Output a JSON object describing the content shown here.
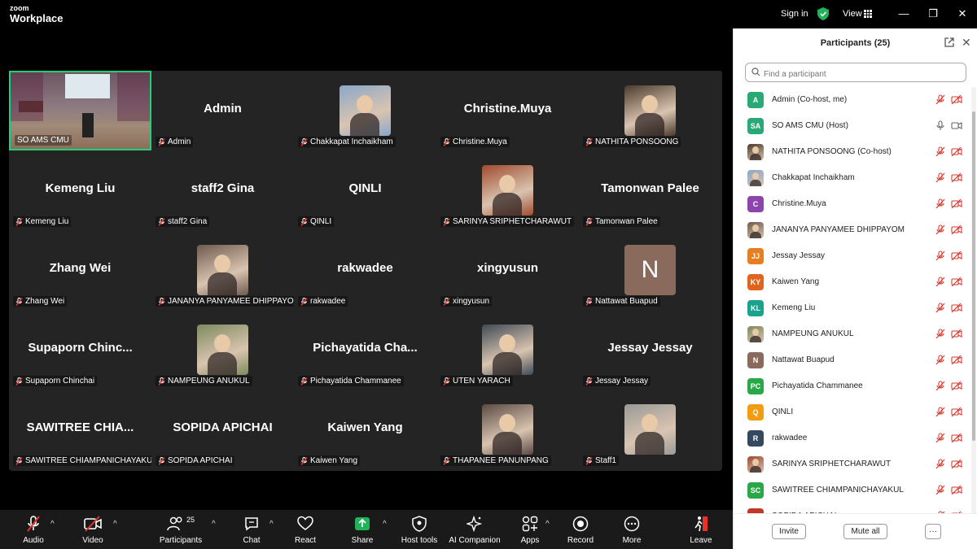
{
  "titlebar": {
    "logo_top": "zoom",
    "logo_bottom": "Workplace",
    "signin": "Sign in",
    "view": "View"
  },
  "tiles": [
    {
      "name": "",
      "label": "SO AMS CMU",
      "kind": "video",
      "row": 0,
      "col": 0
    },
    {
      "name": "Admin",
      "label": "Admin",
      "kind": "name",
      "row": 0,
      "col": 1
    },
    {
      "name": "",
      "label": "Chakkapat Inchaikham",
      "kind": "photo",
      "color": "#8aa7c9",
      "row": 0,
      "col": 2
    },
    {
      "name": "Christine.Muya",
      "label": "Christine.Muya",
      "kind": "name",
      "row": 0,
      "col": 3
    },
    {
      "name": "",
      "label": "NATHITA PONSOONG",
      "kind": "photo",
      "color": "#4b3a2b",
      "row": 0,
      "col": 4
    },
    {
      "name": "Kemeng Liu",
      "label": "Kemeng Liu",
      "kind": "name",
      "row": 1,
      "col": 0
    },
    {
      "name": "staff2 Gina",
      "label": "staff2 Gina",
      "kind": "name",
      "row": 1,
      "col": 1
    },
    {
      "name": "QINLI",
      "label": "QINLI",
      "kind": "name",
      "row": 1,
      "col": 2
    },
    {
      "name": "",
      "label": "SARINYA SRIPHETCHARAWUT",
      "kind": "photo",
      "color": "#a04a2e",
      "row": 1,
      "col": 3
    },
    {
      "name": "Tamonwan Palee",
      "label": "Tamonwan Palee",
      "kind": "name",
      "row": 1,
      "col": 4
    },
    {
      "name": "Zhang Wei",
      "label": "Zhang Wei",
      "kind": "name",
      "row": 2,
      "col": 0
    },
    {
      "name": "",
      "label": "JANANYA PANYAMEE DHIPPAYOM",
      "kind": "photo",
      "color": "#6e5a4e",
      "row": 2,
      "col": 1
    },
    {
      "name": "rakwadee",
      "label": "rakwadee",
      "kind": "name",
      "row": 2,
      "col": 2
    },
    {
      "name": "xingyusun",
      "label": "xingyusun",
      "kind": "name",
      "row": 2,
      "col": 3
    },
    {
      "name": "N",
      "label": "Nattawat Buapud",
      "kind": "letter",
      "color": "#8a6a5c",
      "row": 2,
      "col": 4
    },
    {
      "name": "Supaporn  Chinc...",
      "label": "Supaporn Chinchai",
      "kind": "name",
      "row": 3,
      "col": 0
    },
    {
      "name": "",
      "label": "NAMPEUNG ANUKUL",
      "kind": "photo",
      "color": "#7d8a5e",
      "row": 3,
      "col": 1
    },
    {
      "name": "Pichayatida  Cha...",
      "label": "Pichayatida Chammanee",
      "kind": "name",
      "row": 3,
      "col": 2
    },
    {
      "name": "",
      "label": "UTEN YARACH",
      "kind": "photo",
      "color": "#3f4a55",
      "row": 3,
      "col": 3
    },
    {
      "name": "Jessay Jessay",
      "label": "Jessay Jessay",
      "kind": "name",
      "row": 3,
      "col": 4
    },
    {
      "name": "SAWITREE  CHIA...",
      "label": "SAWITREE CHIAMPANICHAYAKUL",
      "kind": "name",
      "row": 4,
      "col": 0
    },
    {
      "name": "SOPIDA APICHAI",
      "label": "SOPIDA APICHAI",
      "kind": "name",
      "row": 4,
      "col": 1
    },
    {
      "name": "Kaiwen Yang",
      "label": "Kaiwen Yang",
      "kind": "name",
      "row": 4,
      "col": 2
    },
    {
      "name": "",
      "label": "THAPANEE PANUNPANG",
      "kind": "photo",
      "color": "#5a4a44",
      "row": 4,
      "col": 3
    },
    {
      "name": "",
      "label": "Staff1",
      "kind": "photo",
      "color": "#9a9a98",
      "row": 4,
      "col": 4
    }
  ],
  "toolbar": {
    "audio": "Audio",
    "video": "Video",
    "participants": "Participants",
    "participants_count": "25",
    "chat": "Chat",
    "react": "React",
    "share": "Share",
    "hosttools": "Host tools",
    "ai": "AI Companion",
    "apps": "Apps",
    "record": "Record",
    "more": "More",
    "leave": "Leave"
  },
  "panel": {
    "title": "Participants (25)",
    "search_placeholder": "Find a participant",
    "invite": "Invite",
    "mute_all": "Mute all",
    "more": "···",
    "participants": [
      {
        "initials": "A",
        "name": "Admin (Co-host, me)",
        "color": "#2aa876",
        "muted": true
      },
      {
        "initials": "SA",
        "name": "SO AMS CMU (Host)",
        "color": "#2aa876",
        "muted": false
      },
      {
        "initials": "",
        "name": "NATHITA PONSOONG (Co-host)",
        "color": "#4b3a2b",
        "muted": true
      },
      {
        "initials": "",
        "name": "Chakkapat Inchaikham",
        "color": "#8aa7c9",
        "muted": true
      },
      {
        "initials": "C",
        "name": "Christine.Muya",
        "color": "#8e44ad",
        "muted": true
      },
      {
        "initials": "",
        "name": "JANANYA PANYAMEE DHIPPAYOM",
        "color": "#6e5a4e",
        "muted": true
      },
      {
        "initials": "JJ",
        "name": "Jessay Jessay",
        "color": "#e67e22",
        "muted": true
      },
      {
        "initials": "KY",
        "name": "Kaiwen Yang",
        "color": "#e0641e",
        "muted": true
      },
      {
        "initials": "KL",
        "name": "Kemeng Liu",
        "color": "#1aa28a",
        "muted": true
      },
      {
        "initials": "",
        "name": "NAMPEUNG ANUKUL",
        "color": "#7d8a5e",
        "muted": true
      },
      {
        "initials": "N",
        "name": "Nattawat Buapud",
        "color": "#8a6a5c",
        "muted": true
      },
      {
        "initials": "PC",
        "name": "Pichayatida Chammanee",
        "color": "#2aa848",
        "muted": true
      },
      {
        "initials": "Q",
        "name": "QINLI",
        "color": "#f39c12",
        "muted": true
      },
      {
        "initials": "R",
        "name": "rakwadee",
        "color": "#34495e",
        "muted": true
      },
      {
        "initials": "",
        "name": "SARINYA SRIPHETCHARAWUT",
        "color": "#a04a2e",
        "muted": true
      },
      {
        "initials": "SC",
        "name": "SAWITREE CHIAMPANICHAYAKUL",
        "color": "#2aa848",
        "muted": true
      },
      {
        "initials": "SA",
        "name": "SOPIDA APICHAI",
        "color": "#c0392b",
        "muted": true
      }
    ]
  }
}
